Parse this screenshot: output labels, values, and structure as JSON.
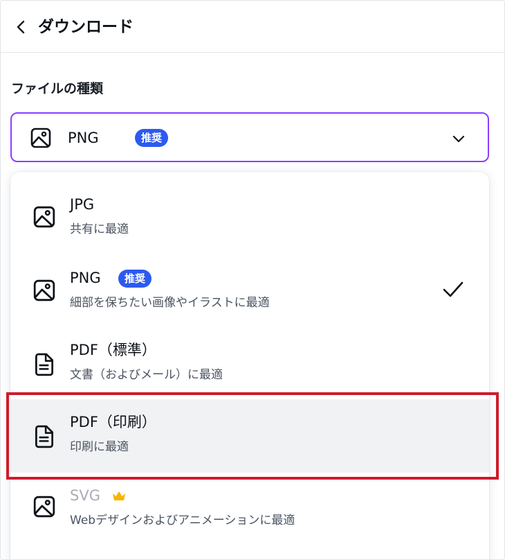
{
  "header": {
    "title": "ダウンロード"
  },
  "file_type": {
    "label": "ファイルの種類",
    "selected_value": "PNG",
    "selected_badge": "推奨"
  },
  "options": [
    {
      "title": "JPG",
      "subtitle": "共有に最適",
      "icon": "image-icon"
    },
    {
      "title": "PNG",
      "badge": "推奨",
      "subtitle": "細部を保ちたい画像やイラストに最適",
      "icon": "image-icon",
      "selected": true
    },
    {
      "title": "PDF（標準）",
      "subtitle": "文書（およびメール）に最適",
      "icon": "document-icon"
    },
    {
      "title": "PDF（印刷）",
      "subtitle": "印刷に最適",
      "icon": "document-icon",
      "highlighted": true
    },
    {
      "title": "SVG",
      "subtitle": "Webデザインおよびアニメーションに最適",
      "icon": "image-icon",
      "pro": "crown-icon"
    }
  ],
  "colors": {
    "accent": "#8b3dff",
    "badge": "#2c5af0",
    "highlight": "#f1f2f4",
    "annotation": "#cc1c2a",
    "crown": "#f7b500"
  }
}
